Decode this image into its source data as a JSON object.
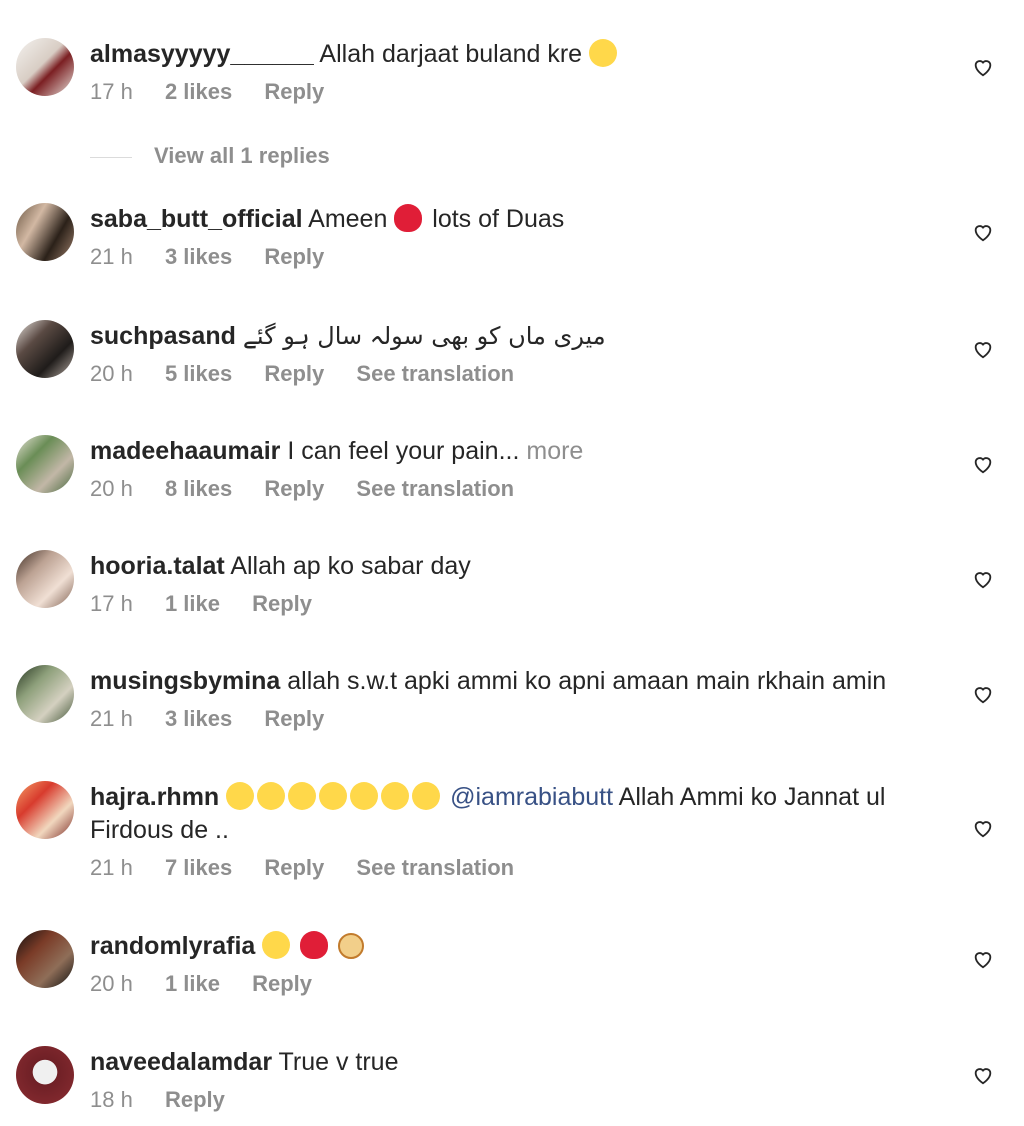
{
  "view_replies": "View all 1 replies",
  "comments": [
    {
      "username": "almasyyyyy______",
      "text": "Allah darjaat buland kre",
      "time": "17 h",
      "likes": "2 likes",
      "reply": "Reply",
      "translate": ""
    },
    {
      "username": "saba_butt_official",
      "text_a": "Ameen",
      "text_b": "lots of Duas",
      "time": "21 h",
      "likes": "3 likes",
      "reply": "Reply",
      "translate": ""
    },
    {
      "username": "suchpasand",
      "text": "میری ماں کو بھی سولہ سال ہو گئے",
      "time": "20 h",
      "likes": "5 likes",
      "reply": "Reply",
      "translate": "See translation"
    },
    {
      "username": "madeehaaumair",
      "text": "I can feel your pain...",
      "more": "more",
      "time": "20 h",
      "likes": "8 likes",
      "reply": "Reply",
      "translate": "See translation"
    },
    {
      "username": "hooria.talat",
      "text": "Allah ap ko sabar day",
      "time": "17 h",
      "likes": "1 like",
      "reply": "Reply",
      "translate": ""
    },
    {
      "username": "musingsbymina",
      "text": "allah s.w.t apki ammi ko apni amaan main rkhain amin",
      "time": "21 h",
      "likes": "3 likes",
      "reply": "Reply",
      "translate": ""
    },
    {
      "username": "hajra.rhmn",
      "mention": "@iamrabiabutt",
      "text": "Allah Ammi ko Jannat ul Firdous de ..",
      "time": "21 h",
      "likes": "7 likes",
      "reply": "Reply",
      "translate": "See translation"
    },
    {
      "username": "randomlyrafia",
      "time": "20 h",
      "likes": "1 like",
      "reply": "Reply",
      "translate": ""
    },
    {
      "username": "naveedalamdar",
      "text": "True v true",
      "time": "18 h",
      "likes": "",
      "reply": "Reply",
      "translate": ""
    }
  ],
  "colors": {
    "text": "#262626",
    "muted": "#8e8e8e",
    "mention": "#385185",
    "heart_red": "#e01e37"
  },
  "icons": {
    "like": "heart-outline-icon",
    "crying": "crying-face-emoji",
    "pleading": "pleading-face-emoji",
    "heart": "red-heart-emoji"
  }
}
